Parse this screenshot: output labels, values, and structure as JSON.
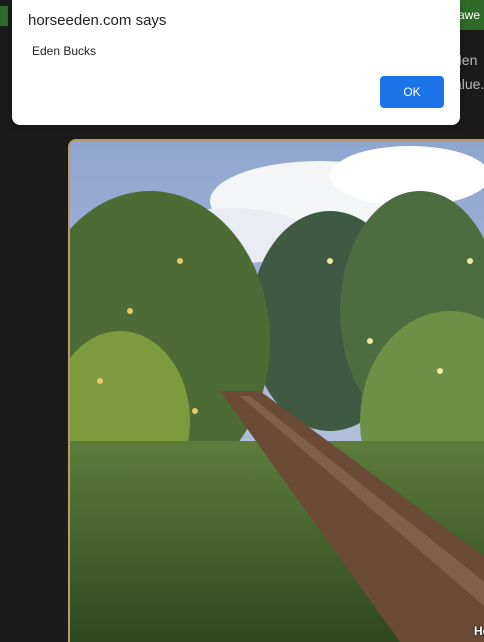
{
  "page": {
    "right_tab_text": "awe",
    "side_lines": [
      "den",
      "alue."
    ]
  },
  "dialog": {
    "title": "horseeden.com says",
    "message": "Eden Bucks",
    "ok_label": "OK"
  },
  "artwork": {
    "caption": "Ho"
  }
}
